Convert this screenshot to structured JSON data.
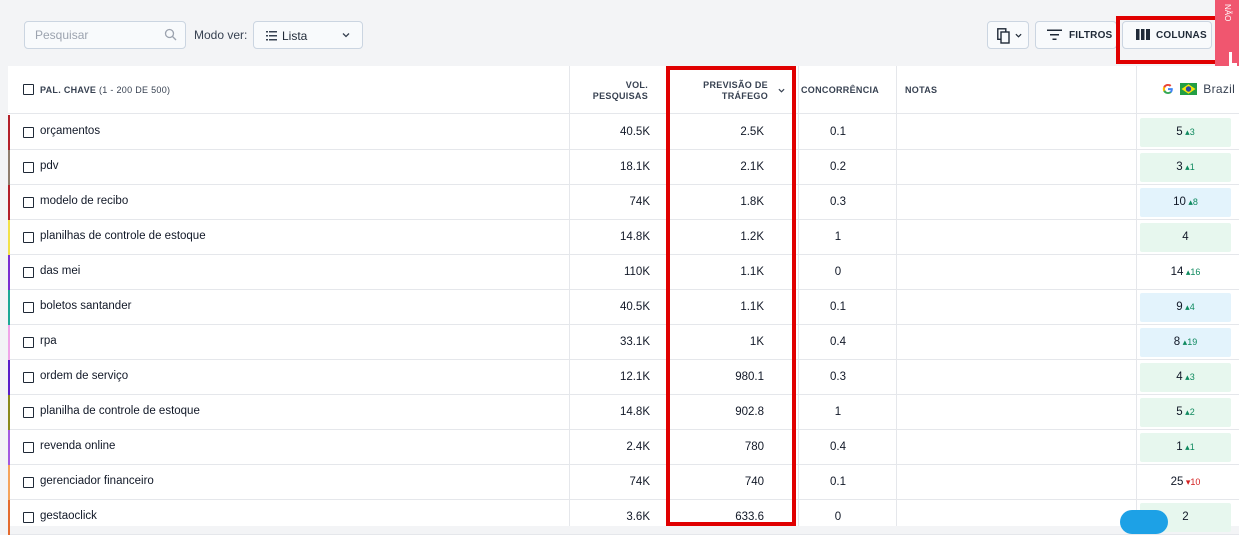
{
  "toolbar": {
    "search_placeholder": "Pesquisar",
    "view_mode_label": "Modo ver:",
    "view_mode_value": "Lista",
    "filters_label": "FILTROS",
    "columns_label": "COLUNAS"
  },
  "side_tab_text": "NÃO",
  "header": {
    "keyword": "PAL. CHAVE",
    "keyword_count": "(1 - 200 DE 500)",
    "volume_line1": "VOL.",
    "volume_line2": "PESQUISAS",
    "traffic_line1": "PREVISÃO DE",
    "traffic_line2": "TRÁFEGO",
    "competition": "CONCORRÊNCIA",
    "notes": "NOTAS",
    "rank_region": "Brazil"
  },
  "rows": [
    {
      "keyword": "orçamentos",
      "volume": "40.5K",
      "traffic": "2.5K",
      "competition": "0.1",
      "rank": "5",
      "delta": "3",
      "dir": "up",
      "color": "#b3202a",
      "rank_bg": "#e7f7ee"
    },
    {
      "keyword": "pdv",
      "volume": "18.1K",
      "traffic": "2.1K",
      "competition": "0.2",
      "rank": "3",
      "delta": "1",
      "dir": "up",
      "color": "#8f7e6e",
      "rank_bg": "#e7f7ee"
    },
    {
      "keyword": "modelo de recibo",
      "volume": "74K",
      "traffic": "1.8K",
      "competition": "0.3",
      "rank": "10",
      "delta": "8",
      "dir": "up",
      "color": "#b3202a",
      "rank_bg": "#e3f3fc"
    },
    {
      "keyword": "planilhas de controle de estoque",
      "volume": "14.8K",
      "traffic": "1.2K",
      "competition": "1",
      "rank": "4",
      "delta": "",
      "dir": "",
      "color": "#f2e24a",
      "rank_bg": "#e7f7ee"
    },
    {
      "keyword": "das mei",
      "volume": "110K",
      "traffic": "1.1K",
      "competition": "0",
      "rank": "14",
      "delta": "16",
      "dir": "up",
      "color": "#7b2fd1",
      "rank_bg": "#ffffff"
    },
    {
      "keyword": "boletos santander",
      "volume": "40.5K",
      "traffic": "1.1K",
      "competition": "0.1",
      "rank": "9",
      "delta": "4",
      "dir": "up",
      "color": "#1ea896",
      "rank_bg": "#e3f3fc"
    },
    {
      "keyword": "rpa",
      "volume": "33.1K",
      "traffic": "1K",
      "competition": "0.4",
      "rank": "8",
      "delta": "19",
      "dir": "up",
      "color": "#f0a6e8",
      "rank_bg": "#e3f3fc"
    },
    {
      "keyword": "ordem de serviço",
      "volume": "12.1K",
      "traffic": "980.1",
      "competition": "0.3",
      "rank": "4",
      "delta": "3",
      "dir": "up",
      "color": "#5b1fc9",
      "rank_bg": "#e7f7ee"
    },
    {
      "keyword": "planilha de controle de estoque",
      "volume": "14.8K",
      "traffic": "902.8",
      "competition": "1",
      "rank": "5",
      "delta": "2",
      "dir": "up",
      "color": "#8a8a1c",
      "rank_bg": "#e7f7ee"
    },
    {
      "keyword": "revenda online",
      "volume": "2.4K",
      "traffic": "780",
      "competition": "0.4",
      "rank": "1",
      "delta": "1",
      "dir": "up",
      "color": "#a35ae0",
      "rank_bg": "#e7f7ee"
    },
    {
      "keyword": "gerenciador financeiro",
      "volume": "74K",
      "traffic": "740",
      "competition": "0.1",
      "rank": "25",
      "delta": "10",
      "dir": "down",
      "color": "#f5a35b",
      "rank_bg": "#ffffff"
    },
    {
      "keyword": "gestaoclick",
      "volume": "3.6K",
      "traffic": "633.6",
      "competition": "0",
      "rank": "2",
      "delta": "",
      "dir": "",
      "color": "#e46b2e",
      "rank_bg": "#e7f7ee"
    }
  ],
  "colors": {
    "highlight": "#e00000",
    "up": "#0f8a5f",
    "down": "#d42020"
  },
  "icons": [
    "search-icon",
    "list-icon",
    "chevron-down-icon",
    "copy-icon",
    "filter-icon",
    "columns-icon",
    "google-icon",
    "brazil-flag-icon",
    "chat-icon"
  ]
}
